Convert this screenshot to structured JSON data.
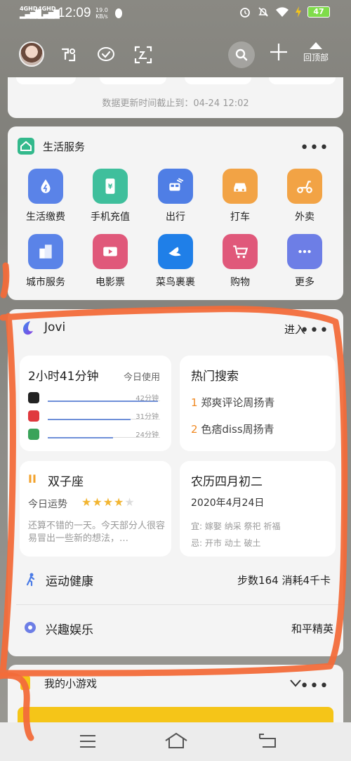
{
  "status_bar": {
    "sim1": "4GHD",
    "sim2": "4GHD",
    "time": "12:09",
    "speed_value": "19.0",
    "speed_unit": "KB/s",
    "battery": "47"
  },
  "top_bar": {
    "back_to_top": "回顶部"
  },
  "data_card": {
    "update_text": "数据更新时间截止到：04-24 12:02"
  },
  "life_services": {
    "title": "生活服务",
    "more": "•••",
    "items": [
      {
        "label": "生活缴费",
        "icon": "water-drop-icon",
        "color": "#5a83e8"
      },
      {
        "label": "手机充值",
        "icon": "phone-yuan-icon",
        "color": "#3fbf9c"
      },
      {
        "label": "出行",
        "icon": "train-icon",
        "color": "#4f7ee5"
      },
      {
        "label": "打车",
        "icon": "car-icon",
        "color": "#f2a345"
      },
      {
        "label": "外卖",
        "icon": "scooter-icon",
        "color": "#f2a345"
      },
      {
        "label": "城市服务",
        "icon": "buildings-icon",
        "color": "#5a83e8"
      },
      {
        "label": "电影票",
        "icon": "ticket-icon",
        "color": "#e0587a"
      },
      {
        "label": "菜鸟裹裹",
        "icon": "cainiao-bird-icon",
        "color": "#1f7fe8"
      },
      {
        "label": "购物",
        "icon": "cart-icon",
        "color": "#e0587a"
      },
      {
        "label": "更多",
        "icon": "more-icon",
        "color": "#6d7ee6"
      }
    ]
  },
  "jovi": {
    "title": "Jovi",
    "enter": "进入",
    "more": "•••",
    "usage": {
      "total": "2小时41分钟",
      "label": "今日使用",
      "apps": [
        {
          "icon": "qq-icon",
          "time": "42分钟",
          "fraction": 0.98,
          "color": "#222"
        },
        {
          "icon": "wps-icon",
          "time": "31分钟",
          "fraction": 0.74,
          "color": "#e0393e"
        },
        {
          "icon": "wechat-icon",
          "time": "24分钟",
          "fraction": 0.58,
          "color": "#3aa35a"
        }
      ]
    },
    "hot_search": {
      "title": "热门搜索",
      "items": [
        {
          "rank": "1",
          "text": "郑爽评论周扬青"
        },
        {
          "rank": "2",
          "text": "色痞diss周扬青"
        }
      ]
    },
    "horoscope": {
      "symbol": "II",
      "sign": "双子座",
      "fortune_label": "今日运势",
      "stars": 4,
      "max_stars": 5,
      "text": "还算不错的一天。今天部分人很容易冒出一些新的想法，…"
    },
    "calendar": {
      "lunar": "农历四月初二",
      "date": "2020年4月24日",
      "yi_label": "宜:",
      "yi": "嫁娶 纳采 祭祀 祈福",
      "ji_label": "忌:",
      "ji": "开市 动土 破土"
    },
    "sports": {
      "label": "运动健康",
      "value": "步数164 消耗4千卡"
    },
    "entertainment": {
      "label": "兴趣娱乐",
      "value": "和平精英"
    }
  },
  "mini_games": {
    "title": "我的小游戏",
    "more": "•••"
  }
}
